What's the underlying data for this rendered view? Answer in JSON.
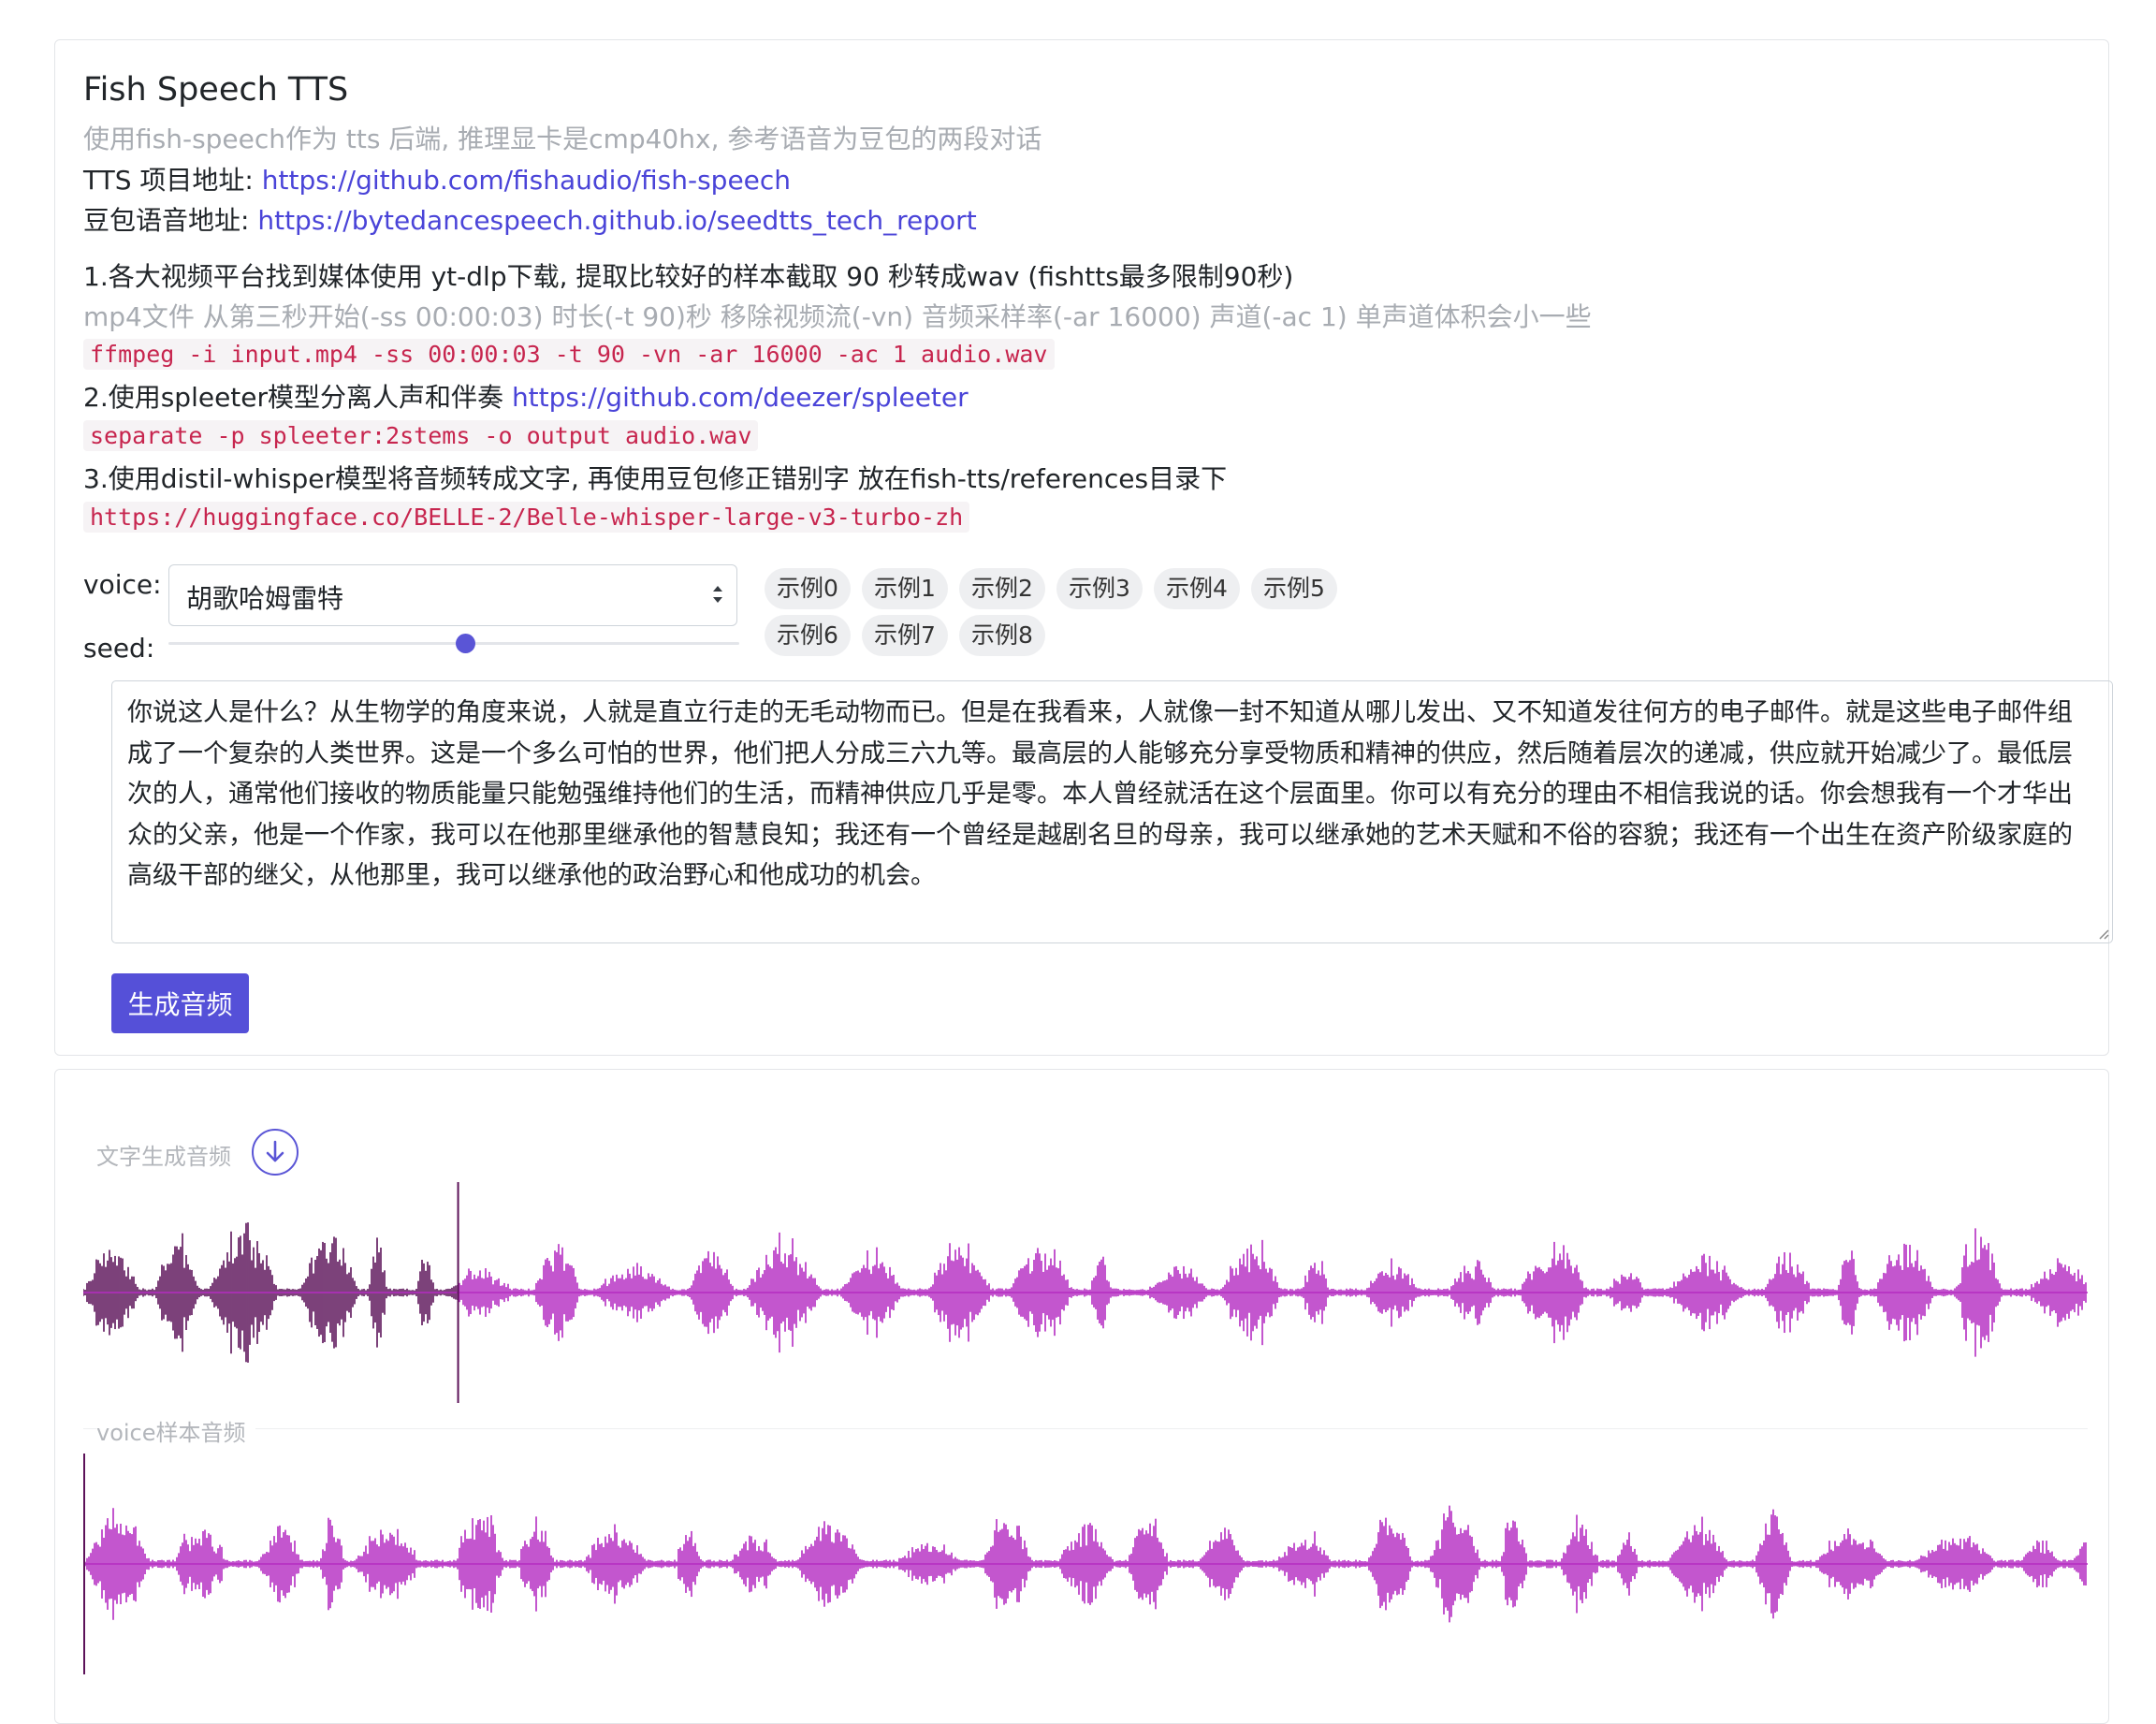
{
  "header": {
    "title": "Fish Speech TTS",
    "subtitle": "使用fish-speech作为 tts 后端, 推理显卡是cmp40hx, 参考语音为豆包的两段对话",
    "tts_label": "TTS 项目地址: ",
    "tts_url": "https://github.com/fishaudio/fish-speech",
    "doubao_label": "豆包语音地址: ",
    "doubao_url": "https://bytedancespeech.github.io/seedtts_tech_report"
  },
  "steps": {
    "step1": "1.各大视频平台找到媒体使用 yt-dlp下载, 提取比较好的样本截取 90 秒转成wav (fishtts最多限制90秒)",
    "step1_note": "mp4文件 从第三秒开始(-ss 00:00:03) 时长(-t 90)秒 移除视频流(-vn) 音频采样率(-ar 16000) 声道(-ac 1) 单声道体积会小一些",
    "step1_code": "ffmpeg -i input.mp4 -ss 00:00:03 -t 90 -vn -ar 16000 -ac 1 audio.wav",
    "step2": "2.使用spleeter模型分离人声和伴奏 ",
    "step2_url": "https://github.com/deezer/spleeter",
    "step2_code": "separate -p spleeter:2stems -o output audio.wav",
    "step3": "3.使用distil-whisper模型将音频转成文字, 再使用豆包修正错别字 放在fish-tts/references目录下",
    "step3_code": "https://huggingface.co/BELLE-2/Belle-whisper-large-v3-turbo-zh"
  },
  "form": {
    "voice_label": "voice:",
    "voice_value": "胡歌哈姆雷特",
    "seed_label": "seed:",
    "seed_fraction": 0.52,
    "examples": [
      "示例0",
      "示例1",
      "示例2",
      "示例3",
      "示例4",
      "示例5",
      "示例6",
      "示例7",
      "示例8"
    ],
    "text": "你说这人是什么？从生物学的角度来说，人就是直立行走的无毛动物而已。但是在我看来，人就像一封不知道从哪儿发出、又不知道发往何方的电子邮件。就是这些电子邮件组成了一个复杂的人类世界。这是一个多么可怕的世界，他们把人分成三六九等。最高层的人能够充分享受物质和精神的供应，然后随着层次的递减，供应就开始减少了。最低层次的人，通常他们接收的物质能量只能勉强维持他们的生活，而精神供应几乎是零。本人曾经就活在这个层面里。你可以有充分的理由不相信我说的话。你会想我有一个才华出众的父亲，他是一个作家，我可以在他那里继承他的智慧良知；我还有一个曾经是越剧名旦的母亲，我可以继承她的艺术天赋和不俗的容貌；我还有一个出生在资产阶级家庭的高级干部的继父，从他那里，我可以继承他的政治野心和他成功的机会。",
    "generate_label": "生成音频"
  },
  "audio": {
    "generated_label": "文字生成音频",
    "sample_label": "voice样本音频",
    "generated_progress": 0.187,
    "sample_progress": 0.0,
    "played_color": "#5c1259",
    "wave_color": "#b42cc1",
    "accent_color": "#5550d8"
  }
}
